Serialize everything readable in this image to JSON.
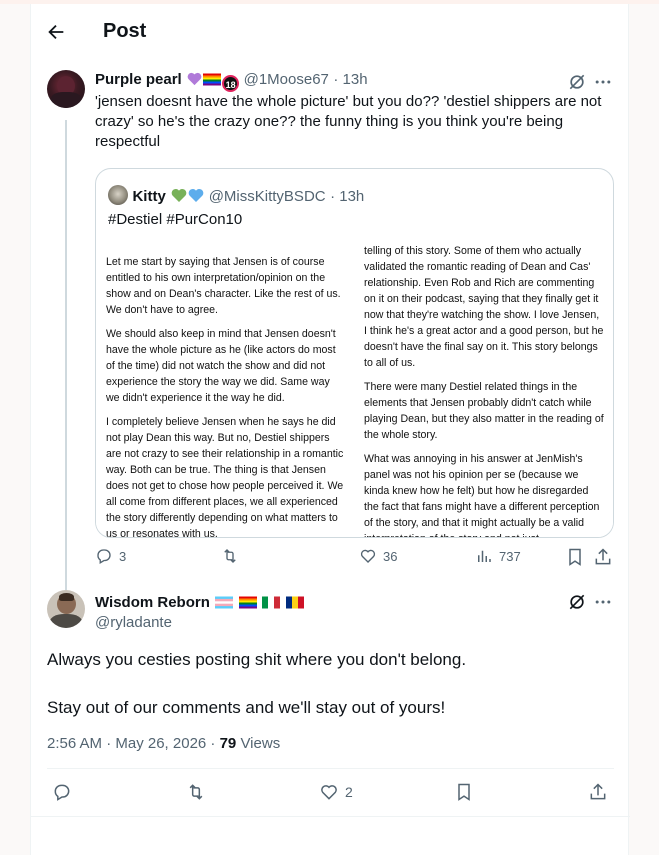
{
  "header": {
    "title": "Post"
  },
  "post1": {
    "name": "Purple pearl",
    "handle": "@1Moose67",
    "time": "13h",
    "text": "'jensen doesnt have the whole picture' but you do?? 'destiel shippers are not crazy' so he's the crazy one?? the funny thing is you think you're being respectful",
    "badge_text": "18",
    "quote": {
      "name": "Kitty",
      "handle": "@MissKittyBSDC",
      "time": "13h",
      "text": "#Destiel #PurCon10",
      "image_left": [
        "Let me start by saying that Jensen is of course entitled to his own interpretation/opinion on the show and on Dean's character. Like the rest of us. We don't have to agree.",
        "We should also keep in mind that Jensen doesn't have the whole picture as he (like actors do most of the time) did not watch the show and did not experience the story the way we did. Same way we didn't experience it the way he did.",
        "I completely believe Jensen when he says he did not play Dean this way. But no, Destiel shippers are not crazy to see their relationship in a romantic way. Both can be true. The thing is that Jensen does not get to chose how people perceived it. We all come from different places, we all experienced the story differently depending on what matters to us or resonates with us."
      ],
      "image_right": [
        "telling of this story. Some of them who actually validated the romantic reading of Dean and Cas' relationship. Even Rob and Rich are commenting on it on their podcast, saying that they finally get it now that they're watching the show. I love Jensen, I think he's a great actor and a good person, but he doesn't have the final say on it. This story belongs to all of us.",
        "There were many Destiel related things in the elements that Jensen probably didn't catch while playing Dean, but they also matter in the reading of the whole story.",
        "What was annoying in his answer at JenMish's panel was not his opinion per se (because we kinda knew how he felt) but how he disregarded the fact that fans might have a different perception of the story, and that it might actually be a valid interpretation of the story and not just"
      ]
    },
    "stats": {
      "replies": "3",
      "likes": "36",
      "views": "737"
    }
  },
  "post2": {
    "name": "Wisdom Reborn",
    "handle": "@ryladante",
    "text_line1": "Always you cesties posting shit where you don't belong.",
    "text_line2": "Stay out of our comments and we'll stay out of yours!",
    "timestamp": "2:56 AM · May 26, 2026 · ",
    "views_count": "79",
    "views_label": " Views",
    "stats": {
      "likes": "2"
    }
  },
  "icons": [
    "back-arrow-icon",
    "grok-icon",
    "more-icon",
    "reply-icon",
    "repost-icon",
    "like-icon",
    "views-icon",
    "bookmark-icon",
    "share-icon"
  ],
  "colors": {
    "text": "#0f1419",
    "secondary": "#536471",
    "border": "#cfd9de"
  }
}
